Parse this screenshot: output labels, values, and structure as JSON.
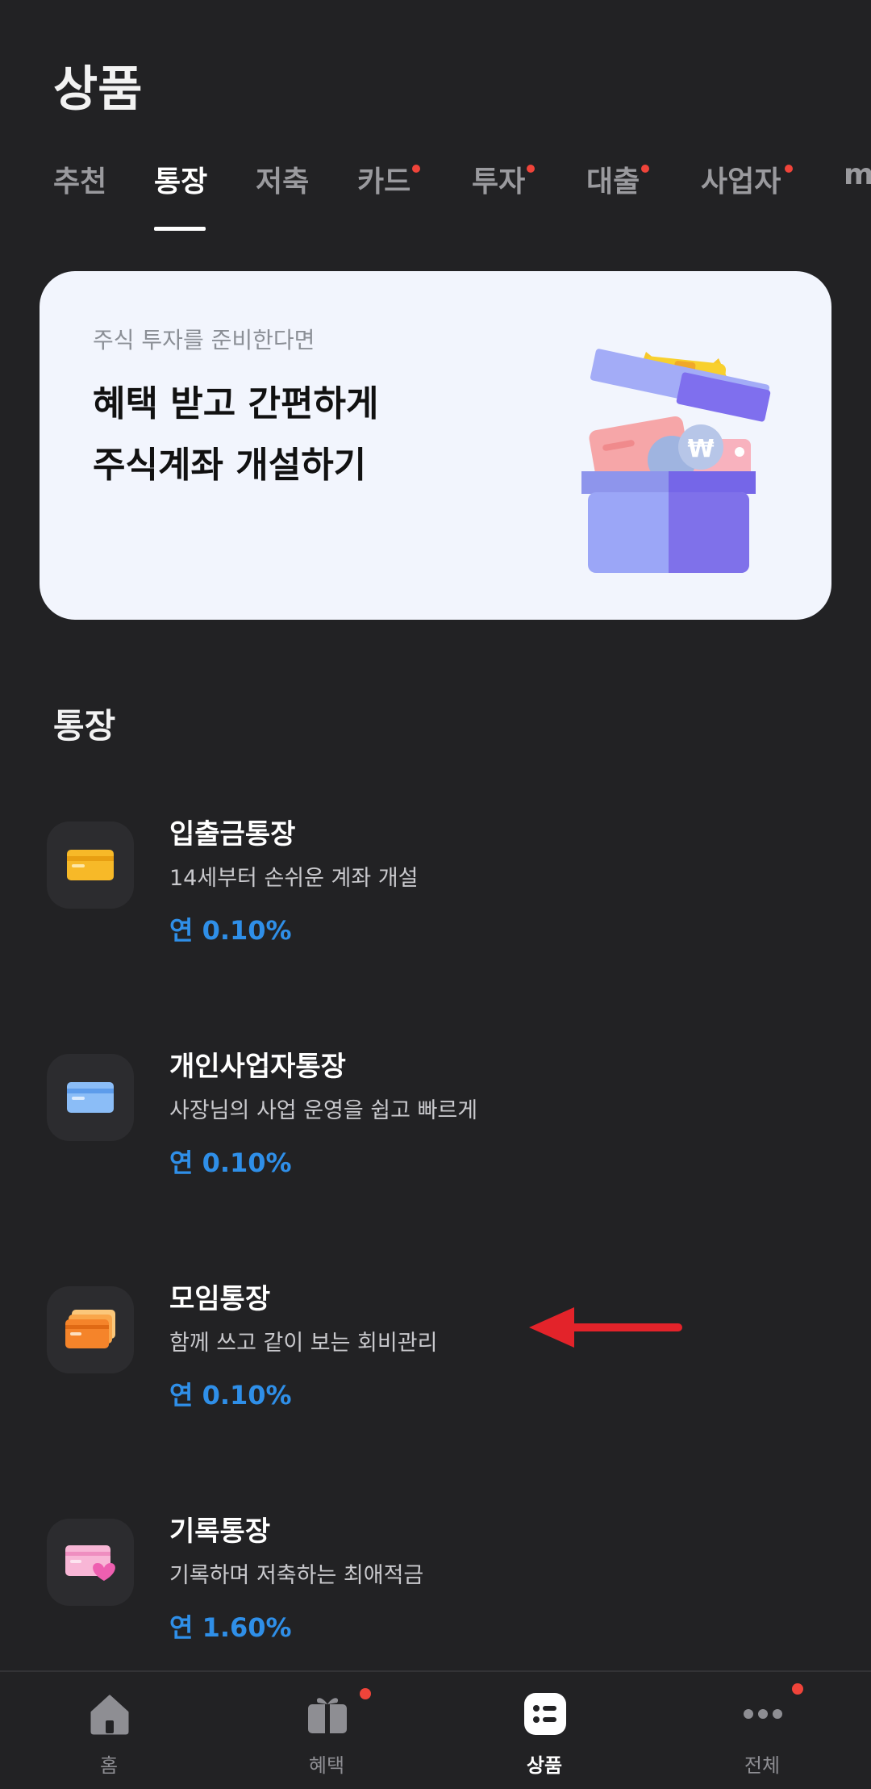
{
  "header": {
    "title": "상품"
  },
  "tabs": [
    {
      "label": "추천",
      "active": false,
      "dot": false
    },
    {
      "label": "통장",
      "active": true,
      "dot": false
    },
    {
      "label": "저축",
      "active": false,
      "dot": false
    },
    {
      "label": "카드",
      "active": false,
      "dot": true
    },
    {
      "label": "투자",
      "active": false,
      "dot": true
    },
    {
      "label": "대출",
      "active": false,
      "dot": true
    },
    {
      "label": "사업자",
      "active": false,
      "dot": true
    },
    {
      "label": "m",
      "active": false,
      "dot": false
    }
  ],
  "banner": {
    "subtitle": "주식 투자를 준비한다면",
    "line1": "혜택 받고 간편하게",
    "line2": "주식계좌 개설하기",
    "coin_symbol": "₩"
  },
  "section": {
    "title": "통장"
  },
  "products": [
    {
      "name": "입출금통장",
      "desc": "14세부터 손쉬운 계좌 개설",
      "rate": "연 0.10%",
      "icon": "card-yellow-icon",
      "color": "#f7b928"
    },
    {
      "name": "개인사업자통장",
      "desc": "사장님의 사업 운영을 쉽고 빠르게",
      "rate": "연 0.10%",
      "icon": "card-blue-icon",
      "color": "#7fb6f5"
    },
    {
      "name": "모임통장",
      "desc": "함께 쓰고 같이 보는 회비관리",
      "rate": "연 0.10%",
      "icon": "cards-orange-icon",
      "color": "#f5842a"
    },
    {
      "name": "기록통장",
      "desc": "기록하며 저축하는 최애적금",
      "rate": "연 1.60%",
      "icon": "card-heart-icon",
      "color": "#f39ac9"
    }
  ],
  "bottom_nav": [
    {
      "label": "홈",
      "icon": "home-icon",
      "active": false,
      "dot": false
    },
    {
      "label": "혜택",
      "icon": "gift-icon",
      "active": false,
      "dot": true
    },
    {
      "label": "상품",
      "icon": "list-icon",
      "active": true,
      "dot": false
    },
    {
      "label": "전체",
      "icon": "more-icon",
      "active": false,
      "dot": true
    }
  ],
  "colors": {
    "background": "#222224",
    "accent_rate": "#2f8fe8",
    "badge": "#f0443a",
    "annotation_arrow": "#e3232a"
  }
}
